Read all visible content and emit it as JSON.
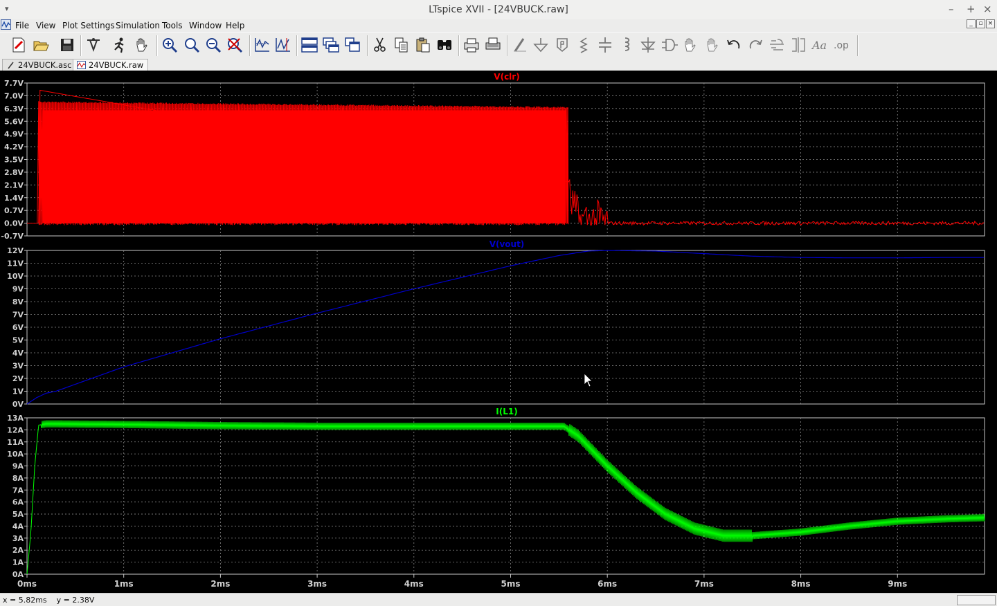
{
  "window": {
    "title": "LTspice XVII - [24VBUCK.raw]",
    "menu_glyph": "▾",
    "controls": [
      "–",
      "+",
      "×"
    ]
  },
  "menu": [
    "File",
    "View",
    "Plot Settings",
    "Simulation",
    "Tools",
    "Window",
    "Help"
  ],
  "mdi_controls": [
    "_",
    "▫",
    "×"
  ],
  "toolbar": {
    "groups": [
      [
        "new-schematic-icon",
        "open-icon",
        "save-icon"
      ],
      [
        "control-panel-icon",
        "run-icon",
        "pan-hand-icon"
      ],
      [
        "zoom-in-icon",
        "zoom-area-icon",
        "zoom-out-icon",
        "zoom-cancel-icon"
      ],
      [
        "autorange-icon",
        "pick-visible-traces-icon"
      ],
      [
        "tile-horizontal-icon",
        "cascade-icon",
        "tile-vertical-icon"
      ],
      [
        "cut-icon",
        "copy-icon",
        "paste-icon",
        "find-icon"
      ],
      [
        "print-preview-icon",
        "print-icon"
      ],
      [
        "wire-icon",
        "ground-icon",
        "label-net-icon",
        "resistor-icon",
        "capacitor-icon",
        "inductor-icon",
        "diode-icon",
        "component-icon",
        "move-icon",
        "drag-icon",
        "undo-icon",
        "redo-icon",
        "rotate-icon",
        "mirror-icon",
        "text-icon",
        "spice-directive-icon"
      ]
    ]
  },
  "tabs": [
    {
      "label": "24VBUCK.asc",
      "icon": "schematic-tab-icon",
      "active": false
    },
    {
      "label": "24VBUCK.raw",
      "icon": "waveform-tab-icon",
      "active": true
    }
  ],
  "chart_data": [
    {
      "type": "line",
      "title": "V(clr)",
      "color": "#ff0000",
      "yticks": [
        "7.7V",
        "7.0V",
        "6.3V",
        "5.6V",
        "4.9V",
        "4.2V",
        "3.5V",
        "2.8V",
        "2.1V",
        "1.4V",
        "0.7V",
        "0.0V",
        "-0.7V"
      ],
      "ylim": [
        -0.7,
        7.7
      ],
      "xlim": [
        0,
        9.9
      ],
      "envelope": {
        "switch_start_ms": 0.12,
        "switch_end_ms": 5.6,
        "peak_start": 7.3,
        "high_start": 6.7,
        "high_end": 6.4,
        "low": 0.0
      },
      "x": [
        0,
        0.12,
        0.15,
        1,
        2,
        3,
        4,
        5,
        5.55,
        5.6,
        5.7,
        6,
        9.9
      ],
      "y": [
        0,
        7.3,
        6.7,
        6.65,
        6.6,
        6.55,
        6.5,
        6.45,
        6.4,
        1.5,
        0.2,
        0.0,
        0.0
      ]
    },
    {
      "type": "line",
      "title": "V(vout)",
      "color": "#0000cc",
      "yticks": [
        "12V",
        "11V",
        "10V",
        "9V",
        "8V",
        "7V",
        "6V",
        "5V",
        "4V",
        "3V",
        "2V",
        "1V",
        "0V"
      ],
      "ylim": [
        0,
        12
      ],
      "xlim": [
        0,
        9.9
      ],
      "x": [
        0,
        0.1,
        0.2,
        0.3,
        1,
        2,
        3,
        4,
        5,
        5.5,
        5.8,
        6,
        6.5,
        7,
        7.5,
        8,
        8.5,
        9,
        9.5,
        9.9
      ],
      "y": [
        0,
        0.5,
        0.85,
        1.0,
        2.9,
        5.1,
        7.1,
        9.0,
        10.8,
        11.6,
        11.95,
        12.0,
        11.95,
        11.75,
        11.55,
        11.45,
        11.42,
        11.42,
        11.45,
        11.45
      ]
    },
    {
      "type": "line",
      "title": "I(L1)",
      "color": "#00ff00",
      "yticks": [
        "13A",
        "12A",
        "11A",
        "10A",
        "9A",
        "8A",
        "7A",
        "6A",
        "5A",
        "4A",
        "3A",
        "2A",
        "1A",
        "0A"
      ],
      "ylim": [
        0,
        13
      ],
      "xlim": [
        0,
        9.9
      ],
      "ripple_A": 0.3,
      "x": [
        0,
        0.04,
        0.08,
        0.12,
        0.2,
        1,
        2,
        3,
        4,
        5,
        5.55,
        5.7,
        6,
        6.3,
        6.6,
        6.9,
        7.2,
        7.5,
        8,
        8.5,
        9,
        9.5,
        9.9
      ],
      "y": [
        0,
        3.5,
        9,
        12.4,
        12.5,
        12.45,
        12.35,
        12.3,
        12.3,
        12.3,
        12.3,
        11.5,
        9.0,
        6.8,
        5.0,
        3.8,
        3.2,
        3.2,
        3.5,
        4.0,
        4.4,
        4.6,
        4.7
      ]
    }
  ],
  "x_axis": {
    "ticks": [
      "0ms",
      "1ms",
      "2ms",
      "3ms",
      "4ms",
      "5ms",
      "6ms",
      "7ms",
      "8ms",
      "9ms"
    ]
  },
  "status": {
    "readout": "x = 5.82ms    y = 2.38V"
  }
}
